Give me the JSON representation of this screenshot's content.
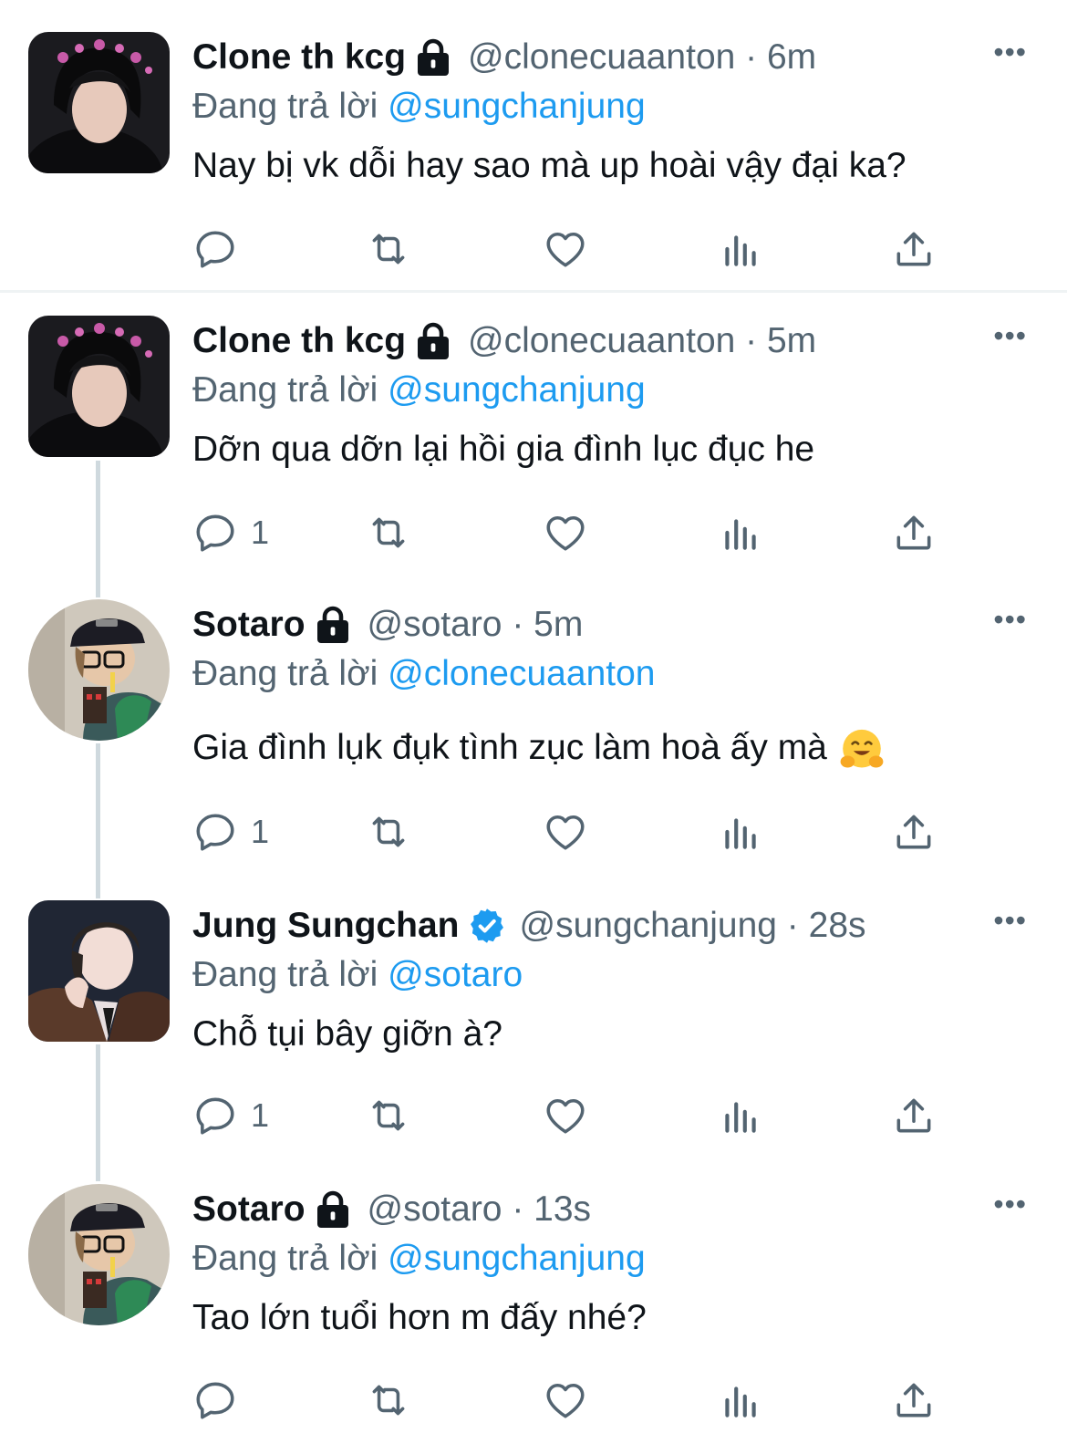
{
  "reply_label": "Đang trả lời",
  "colors": {
    "link": "#1d9bf0",
    "secondary": "#536471",
    "text": "#0f1419",
    "verified": "#1d9bf0"
  },
  "tweets": [
    {
      "name": "Clone th kcg",
      "locked": true,
      "handle_time": "@clonecuaanton · 6m",
      "reply_to": "@sungchanjung",
      "text": "Nay bị vk dỗi hay sao mà up hoài vậy đại ka?",
      "reply_count": ""
    },
    {
      "name": "Clone th kcg",
      "locked": true,
      "handle_time": "@clonecuaanton · 5m",
      "reply_to": "@sungchanjung",
      "text": "Dỡn qua dỡn lại hồi gia đình lục đục he",
      "reply_count": "1"
    },
    {
      "name": "Sotaro",
      "locked": true,
      "handle_time": "@sotaro · 5m",
      "reply_to": "@clonecuaanton",
      "text": "Gia đình lụk đụk tình zục làm hoà ấy mà",
      "emoji": "hugging-face-emoji",
      "reply_count": "1"
    },
    {
      "name": "Jung Sungchan",
      "verified": true,
      "handle_time": "@sungchanjung · 28s",
      "reply_to": "@sotaro",
      "text": "Chỗ tụi bây giỡn à?",
      "reply_count": "1"
    },
    {
      "name": "Sotaro",
      "locked": true,
      "handle_time": "@sotaro · 13s",
      "reply_to": "@sungchanjung",
      "text": "Tao lớn tuổi hơn m đấy nhé?",
      "reply_count": ""
    }
  ],
  "icons": [
    "reply-icon",
    "retweet-icon",
    "like-icon",
    "analytics-icon",
    "share-icon",
    "lock-icon",
    "verified-badge-icon",
    "more-icon"
  ]
}
